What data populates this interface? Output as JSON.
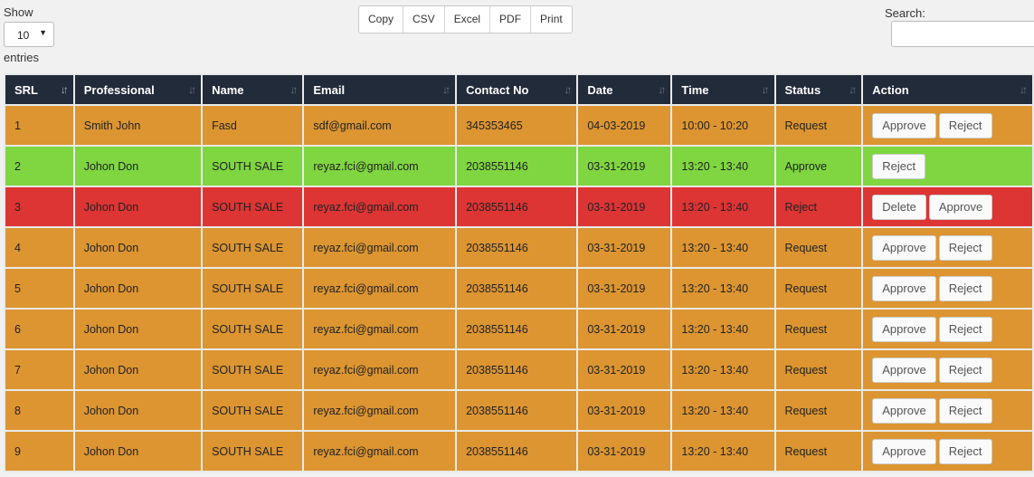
{
  "length_control": {
    "show_label": "Show",
    "selected": "10",
    "entries_label": "entries"
  },
  "export_buttons": [
    "Copy",
    "CSV",
    "Excel",
    "PDF",
    "Print"
  ],
  "search": {
    "label": "Search:",
    "value": ""
  },
  "table": {
    "columns": [
      "SRL",
      "Professional",
      "Name",
      "Email",
      "Contact No",
      "Date",
      "Time",
      "Status",
      "Action"
    ],
    "rows": [
      {
        "srl": "1",
        "professional": "Smith John",
        "name": "Fasd",
        "email": "sdf@gmail.com",
        "contact": "345353465",
        "date": "04-03-2019",
        "time": "10:00 - 10:20",
        "status": "Request",
        "row_type": "request",
        "actions": [
          "Approve",
          "Reject"
        ]
      },
      {
        "srl": "2",
        "professional": "Johon Don",
        "name": "SOUTH SALE",
        "email": "reyaz.fci@gmail.com",
        "contact": "2038551146",
        "date": "03-31-2019",
        "time": "13:20 - 13:40",
        "status": "Approve",
        "row_type": "approve",
        "actions": [
          "Reject"
        ]
      },
      {
        "srl": "3",
        "professional": "Johon Don",
        "name": "SOUTH SALE",
        "email": "reyaz.fci@gmail.com",
        "contact": "2038551146",
        "date": "03-31-2019",
        "time": "13:20 - 13:40",
        "status": "Reject",
        "row_type": "reject",
        "actions": [
          "Delete",
          "Approve"
        ]
      },
      {
        "srl": "4",
        "professional": "Johon Don",
        "name": "SOUTH SALE",
        "email": "reyaz.fci@gmail.com",
        "contact": "2038551146",
        "date": "03-31-2019",
        "time": "13:20 - 13:40",
        "status": "Request",
        "row_type": "request",
        "actions": [
          "Approve",
          "Reject"
        ]
      },
      {
        "srl": "5",
        "professional": "Johon Don",
        "name": "SOUTH SALE",
        "email": "reyaz.fci@gmail.com",
        "contact": "2038551146",
        "date": "03-31-2019",
        "time": "13:20 - 13:40",
        "status": "Request",
        "row_type": "request",
        "actions": [
          "Approve",
          "Reject"
        ]
      },
      {
        "srl": "6",
        "professional": "Johon Don",
        "name": "SOUTH SALE",
        "email": "reyaz.fci@gmail.com",
        "contact": "2038551146",
        "date": "03-31-2019",
        "time": "13:20 - 13:40",
        "status": "Request",
        "row_type": "request",
        "actions": [
          "Approve",
          "Reject"
        ]
      },
      {
        "srl": "7",
        "professional": "Johon Don",
        "name": "SOUTH SALE",
        "email": "reyaz.fci@gmail.com",
        "contact": "2038551146",
        "date": "03-31-2019",
        "time": "13:20 - 13:40",
        "status": "Request",
        "row_type": "request",
        "actions": [
          "Approve",
          "Reject"
        ]
      },
      {
        "srl": "8",
        "professional": "Johon Don",
        "name": "SOUTH SALE",
        "email": "reyaz.fci@gmail.com",
        "contact": "2038551146",
        "date": "03-31-2019",
        "time": "13:20 - 13:40",
        "status": "Request",
        "row_type": "request",
        "actions": [
          "Approve",
          "Reject"
        ]
      },
      {
        "srl": "9",
        "professional": "Johon Don",
        "name": "SOUTH SALE",
        "email": "reyaz.fci@gmail.com",
        "contact": "2038551146",
        "date": "03-31-2019",
        "time": "13:20 - 13:40",
        "status": "Request",
        "row_type": "request",
        "actions": [
          "Approve",
          "Reject"
        ]
      }
    ]
  },
  "colors": {
    "header_bg": "#222b3a",
    "request_row": "#dc9531",
    "approve_row": "#7fd640",
    "reject_row": "#dd3434"
  },
  "icons": {
    "sort": "sort-arrows-icon",
    "dropdown": "caret-down-icon"
  }
}
